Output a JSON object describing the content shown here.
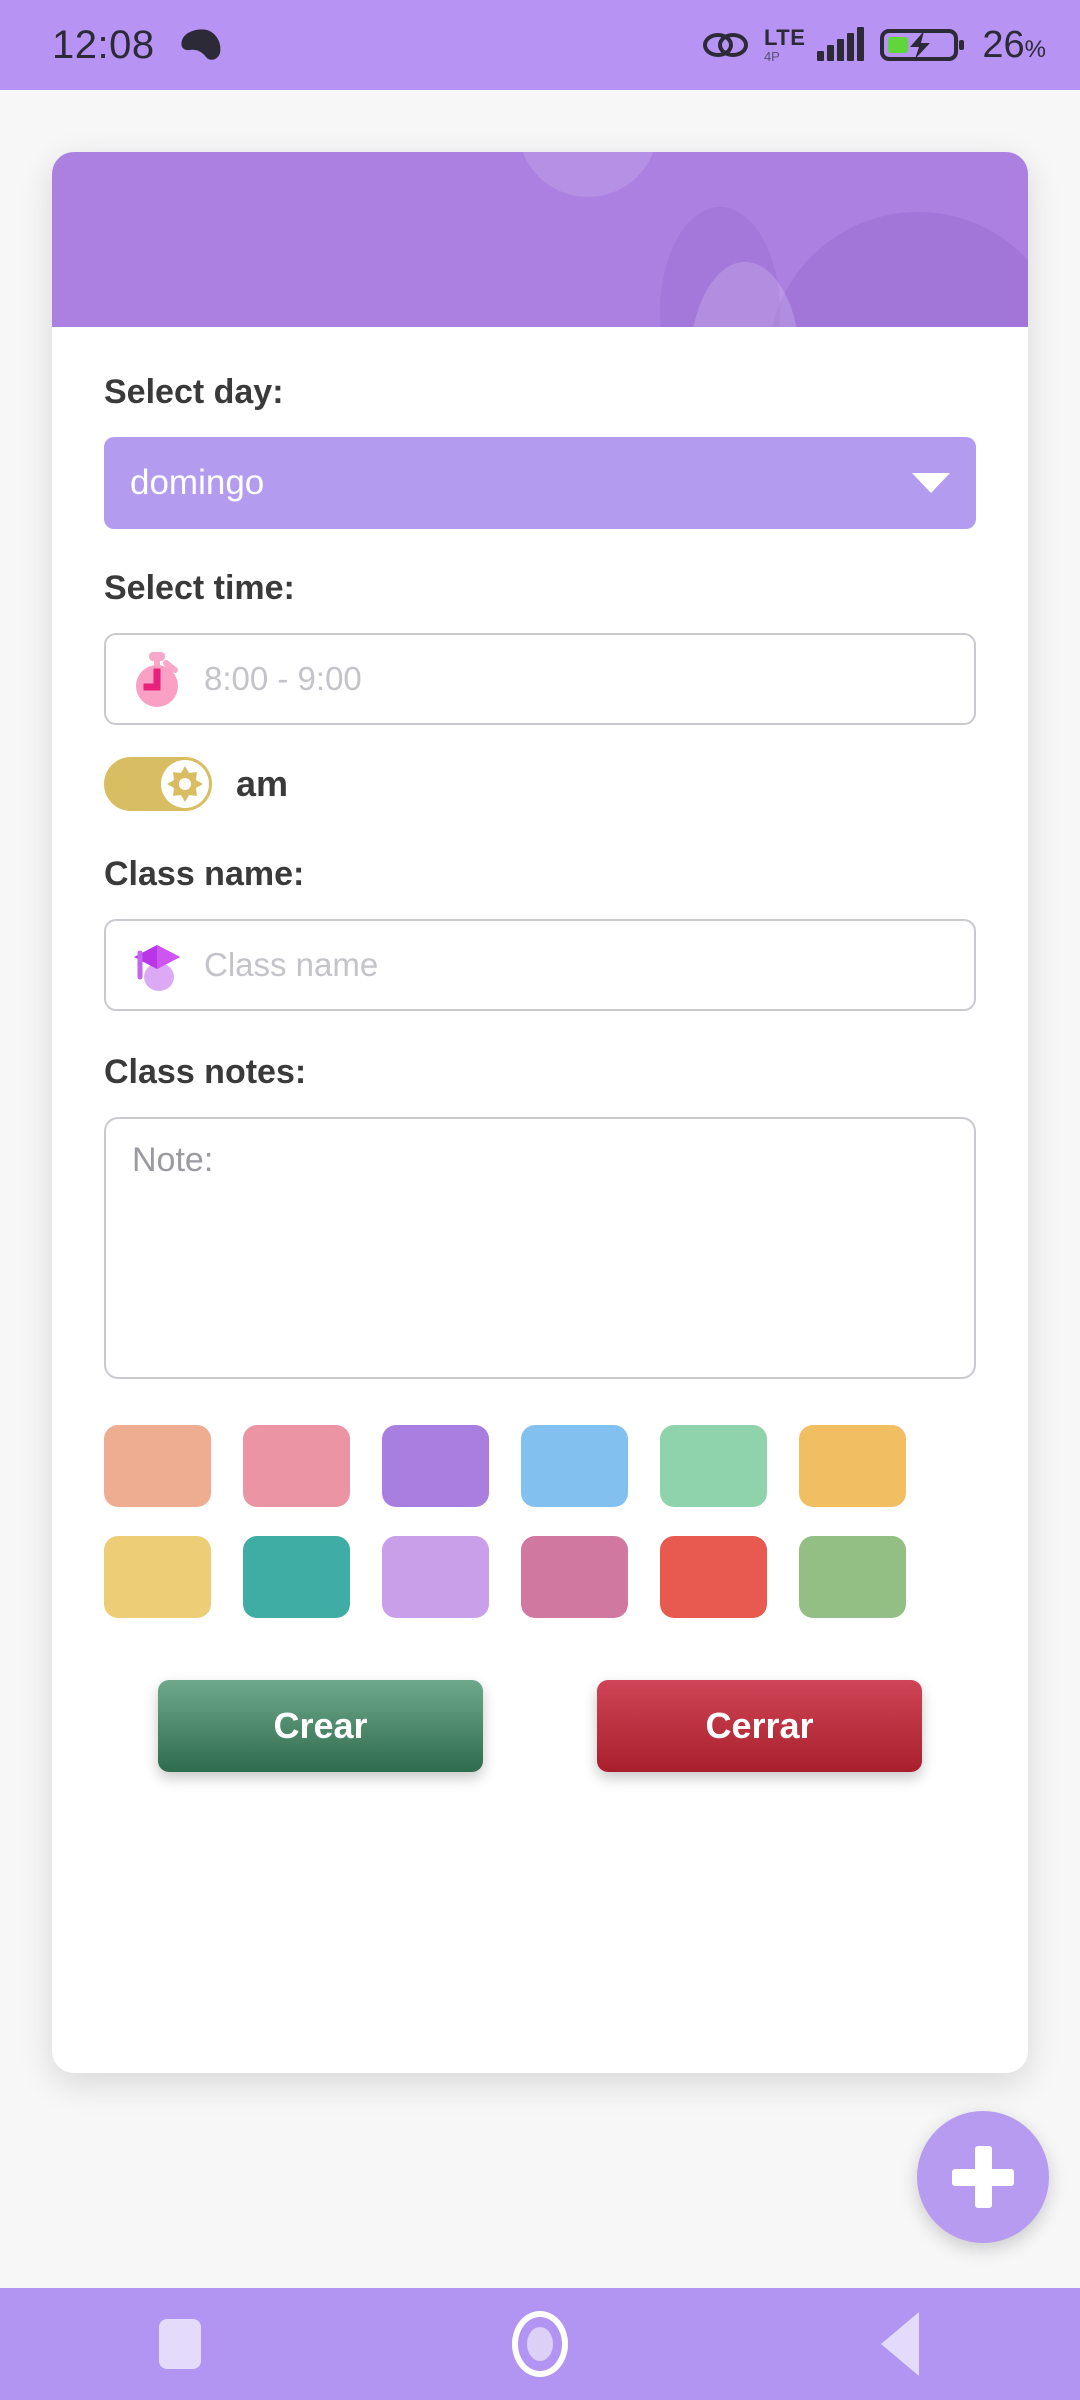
{
  "status_bar": {
    "time": "12:08",
    "game_controller_icon": "game-controller-icon",
    "link_icon": "link-icon",
    "network_type": "LTE",
    "network_sub": "4P",
    "battery_percent": "26",
    "percent_unit": "%"
  },
  "dialog": {
    "day": {
      "label": "Select day:",
      "selected": "domingo"
    },
    "time": {
      "label": "Select time:",
      "placeholder": "8:00 - 9:00",
      "icon": "stopwatch-icon",
      "meridiem_label": "am",
      "meridiem_icon": "sun-icon"
    },
    "class_name": {
      "label": "Class name:",
      "placeholder": "Class name",
      "icon": "graduation-cap-icon"
    },
    "class_notes": {
      "label": "Class notes:",
      "placeholder": "Note:"
    },
    "colors": [
      "#eead90",
      "#ea94a4",
      "#a87fe0",
      "#82c0f0",
      "#8ed3ab",
      "#f2be62",
      "#eecd77",
      "#3fada4",
      "#ca9fea",
      "#d0789f",
      "#e8594f",
      "#93bf84"
    ],
    "actions": {
      "create_label": "Crear",
      "close_label": "Cerrar"
    },
    "header_accent": "#ab80e0"
  },
  "fab": {
    "icon": "plus-icon",
    "color": "#b79bf0"
  },
  "nav_bar": {
    "recents_icon": "square-recents-icon",
    "home_icon": "circle-home-icon",
    "back_icon": "triangle-back-icon",
    "color": "#b295f2"
  }
}
